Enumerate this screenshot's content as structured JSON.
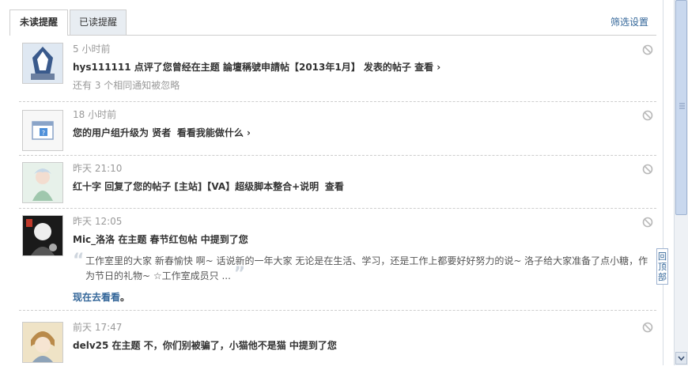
{
  "tabs": {
    "unread": "未读提醒",
    "read": "已读提醒"
  },
  "filter_label": "筛选设置",
  "back_to_top": "回顶部",
  "items": [
    {
      "time": "5 小时前",
      "user": "hys111111",
      "text1": " 点评了您曾经在主题 ",
      "topic": "論壇稱號申請帖【2013年1月】",
      "text2": " 发表的帖子 ",
      "action": "查看 ›",
      "note": "还有 3 个相同通知被忽略"
    },
    {
      "time": "18 小时前",
      "text1": "您的用户组升级为 ",
      "group": "贤者",
      "action": "看看我能做什么 ›"
    },
    {
      "time": "昨天 21:10",
      "user": "红十字",
      "text1": " 回复了您的帖子 ",
      "topic": "[主站]【VA】超级脚本整合+说明",
      "action": "查看"
    },
    {
      "time": "昨天 12:05",
      "user": "Mic_洛洛",
      "text1": " 在主题 ",
      "topic": "春节红包帖",
      "text2": " 中提到了您",
      "quote": "工作室里的大家 新春愉快 啊~ 话说新的一年大家 无论是在生活、学习，还是工作上都要好好努力的说~ 洛子给大家准备了点小糖，作为节日的礼物~ ☆工作室成员只 ...",
      "go": "现在去看看",
      "go_dot": "。"
    },
    {
      "time": "前天 17:47",
      "user": "delv25",
      "text1": " 在主题 ",
      "topic": "不，你们别被骗了，小猫他不是猫",
      "text2": " 中提到了您"
    }
  ],
  "icons": {
    "ignore": "ignore-icon",
    "usergroup": "user-group-upgrade-icon"
  },
  "colors": {
    "link": "#336699",
    "tab_inactive": "#e8edf2"
  }
}
